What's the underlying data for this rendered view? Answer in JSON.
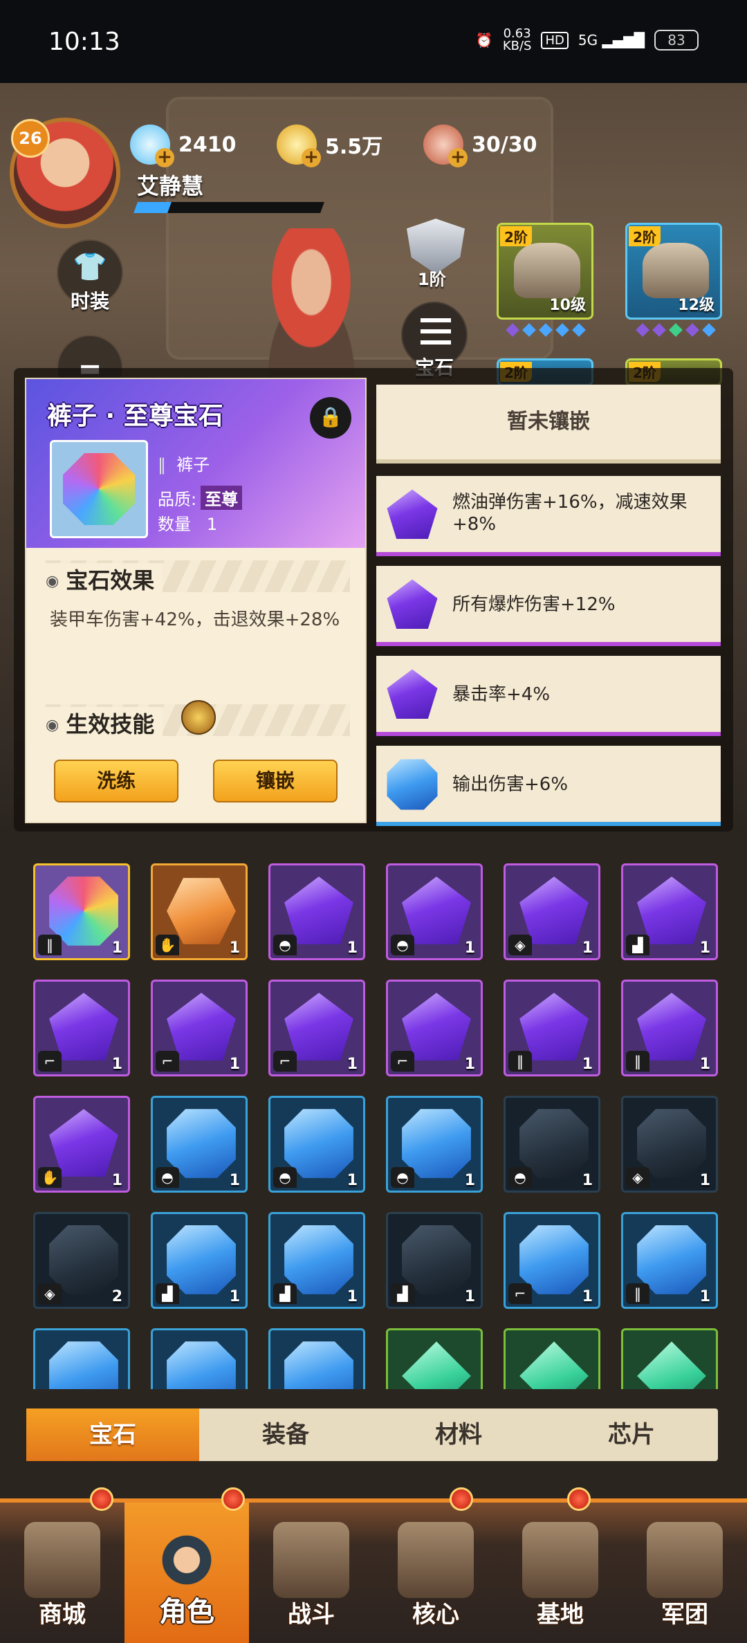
{
  "status_bar": {
    "time": "10:13",
    "net_speed": "0.63",
    "net_unit": "KB/S",
    "hd": "HD",
    "signal": "5G",
    "battery": "83"
  },
  "player": {
    "level": "26",
    "name": "艾静慧"
  },
  "resources": {
    "diamonds": "2410",
    "gold": "5.5万",
    "stamina": "30/30"
  },
  "side_buttons": {
    "costume": "时装"
  },
  "armor": {
    "tier": "1阶",
    "gem_button": "宝石"
  },
  "equipment_slots": [
    {
      "tier": "2阶",
      "level": "10级"
    },
    {
      "tier": "2阶",
      "level": "12级"
    },
    {
      "tier": "2阶"
    },
    {
      "tier": "2阶"
    }
  ],
  "detail": {
    "title": "裤子 · 至尊宝石",
    "part": "裤子",
    "quality_label": "品质:",
    "quality_value": "至尊",
    "count_label": "数量",
    "count_value": "1",
    "effect_heading": "宝石效果",
    "effect_text": "装甲车伤害+42%，击退效果+28%",
    "skill_heading": "生效技能",
    "btn_refine": "洗练",
    "btn_inlay": "镶嵌"
  },
  "inlay_slots": {
    "empty_label": "暂未镶嵌",
    "effects": [
      {
        "text": "燃油弹伤害+16%，减速效果+8%",
        "gem": "purple"
      },
      {
        "text": "所有爆炸伤害+12%",
        "gem": "purple"
      },
      {
        "text": "暴击率+4%",
        "gem": "purple"
      },
      {
        "text": "输出伤害+6%",
        "gem": "blue"
      }
    ]
  },
  "gems": [
    {
      "type": "rainbow",
      "part": "pants",
      "count": "1"
    },
    {
      "type": "orange",
      "part": "gloves",
      "count": "1"
    },
    {
      "type": "purple",
      "part": "helmet",
      "count": "1"
    },
    {
      "type": "purple",
      "part": "helmet",
      "count": "1"
    },
    {
      "type": "purple",
      "part": "armor",
      "count": "1"
    },
    {
      "type": "purple",
      "part": "boots",
      "count": "1"
    },
    {
      "type": "purple",
      "part": "gun",
      "count": "1"
    },
    {
      "type": "purple",
      "part": "gun",
      "count": "1"
    },
    {
      "type": "purple",
      "part": "gun",
      "count": "1"
    },
    {
      "type": "purple",
      "part": "gun",
      "count": "1"
    },
    {
      "type": "purple",
      "part": "pants",
      "count": "1"
    },
    {
      "type": "purple",
      "part": "pants",
      "count": "1"
    },
    {
      "type": "purple",
      "part": "gloves",
      "count": "1"
    },
    {
      "type": "blue",
      "part": "helmet",
      "count": "1"
    },
    {
      "type": "blue",
      "part": "helmet",
      "count": "1"
    },
    {
      "type": "blue",
      "part": "helmet",
      "count": "1"
    },
    {
      "type": "dark",
      "part": "helmet",
      "count": "1"
    },
    {
      "type": "dark",
      "part": "armor",
      "count": "1"
    },
    {
      "type": "dark",
      "part": "armor",
      "count": "2"
    },
    {
      "type": "blue",
      "part": "boots",
      "count": "1"
    },
    {
      "type": "blue",
      "part": "boots",
      "count": "1"
    },
    {
      "type": "dark",
      "part": "boots",
      "count": "1"
    },
    {
      "type": "blue",
      "part": "gun",
      "count": "1"
    },
    {
      "type": "blue",
      "part": "pants",
      "count": "1"
    },
    {
      "type": "blue",
      "part": "",
      "count": ""
    },
    {
      "type": "blue",
      "part": "",
      "count": ""
    },
    {
      "type": "blue",
      "part": "",
      "count": ""
    },
    {
      "type": "green",
      "part": "",
      "count": ""
    },
    {
      "type": "green",
      "part": "",
      "count": ""
    },
    {
      "type": "green",
      "part": "",
      "count": ""
    }
  ],
  "tabs": [
    "宝石",
    "装备",
    "材料",
    "芯片"
  ],
  "bottom_nav": [
    "商城",
    "角色",
    "战斗",
    "核心",
    "基地",
    "军团"
  ]
}
